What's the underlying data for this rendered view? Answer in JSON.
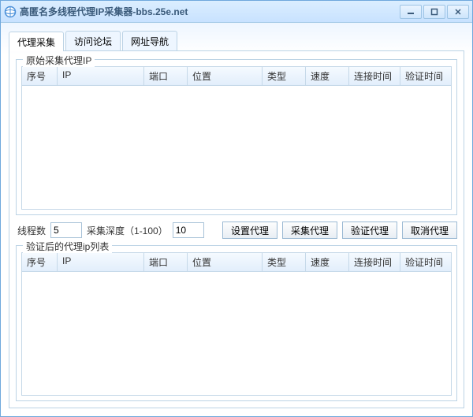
{
  "window": {
    "title": "高匿名多线程代理IP采集器-bbs.25e.net"
  },
  "tabs": [
    {
      "label": "代理采集"
    },
    {
      "label": "访问论坛"
    },
    {
      "label": "网址导航"
    }
  ],
  "groupTop": {
    "title": "原始采集代理IP"
  },
  "groupBottom": {
    "title": "验证后的代理ip列表"
  },
  "columns": {
    "seq": "序号",
    "ip": "IP",
    "port": "端口",
    "loc": "位置",
    "type": "类型",
    "speed": "速度",
    "conn": "连接时间",
    "verify": "验证时间"
  },
  "controls": {
    "threadsLabel": "线程数",
    "threadsValue": "5",
    "depthLabel": "采集深度（1-100）",
    "depthValue": "10",
    "btnSet": "设置代理",
    "btnCollect": "采集代理",
    "btnVerify": "验证代理",
    "btnCancel": "取消代理"
  }
}
